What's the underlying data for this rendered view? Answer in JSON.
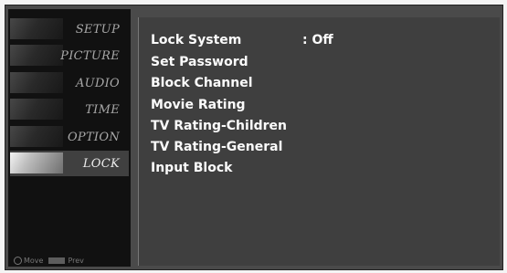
{
  "menu": {
    "items": [
      {
        "label": "SETUP"
      },
      {
        "label": "PICTURE"
      },
      {
        "label": "AUDIO"
      },
      {
        "label": "TIME"
      },
      {
        "label": "OPTION"
      },
      {
        "label": "LOCK",
        "selected": true
      }
    ],
    "bottom_hints": {
      "move": "Move",
      "prev": "Prev"
    }
  },
  "panel": {
    "options": [
      {
        "label": "Lock System"
      },
      {
        "label": "Set Password"
      },
      {
        "label": "Block Channel"
      },
      {
        "label": "Movie Rating"
      },
      {
        "label": "TV Rating-Children"
      },
      {
        "label": "TV Rating-General"
      },
      {
        "label": "Input Block"
      }
    ],
    "lock_system_value": ": Off"
  },
  "colors": {
    "background": "#f4f4f4",
    "frame": "#4a4a4a",
    "left_menu": "#111111",
    "panel": "#3f3f3f",
    "text": "#fbfbfb",
    "menu_text": "#a8a8a8"
  },
  "icons": {
    "move": "move-icon",
    "prev": "prev-icon"
  }
}
